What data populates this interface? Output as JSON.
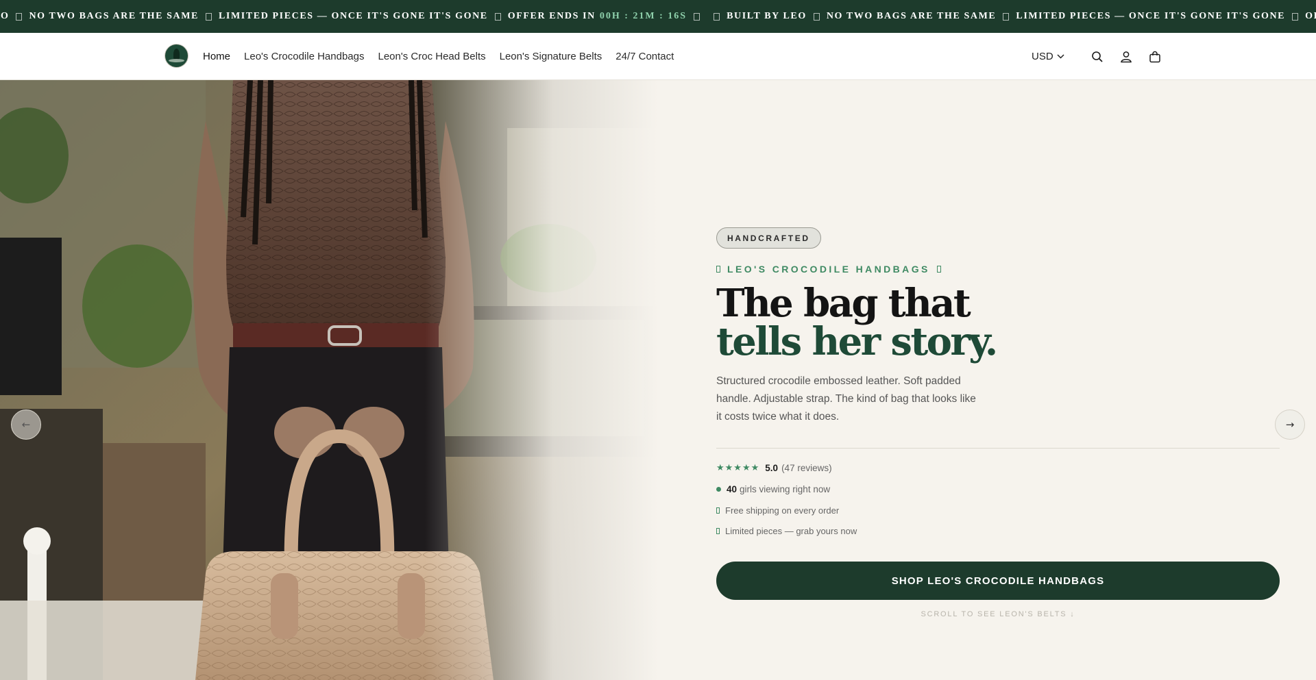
{
  "announcement": {
    "segments": [
      {
        "text": "EO",
        "sep": true
      },
      {
        "text": "NO TWO BAGS ARE THE SAME",
        "sep": true
      },
      {
        "text": "LIMITED PIECES — ONCE IT'S GONE IT'S GONE",
        "sep": true
      },
      {
        "text": "OFFER ENDS IN",
        "timer": "00H : 21M : 16S",
        "sep": true
      },
      {
        "text": "",
        "sep": true
      },
      {
        "text": "BUILT BY LEO",
        "sep": true
      },
      {
        "text": "NO TWO BAGS ARE THE SAME",
        "sep": true
      },
      {
        "text": "LIMITED PIECES — ONCE IT'S GONE IT'S GONE",
        "sep": true
      },
      {
        "text": "OFFER ENDS IN",
        "sep": false
      }
    ],
    "bg_color": "#1d3b2c",
    "timer_color": "#8fd1ac"
  },
  "header": {
    "logo_icon": "brand-logo-tree-icon",
    "nav": [
      {
        "label": "Home",
        "active": true
      },
      {
        "label": "Leo's Crocodile Handbags"
      },
      {
        "label": "Leon's Croc Head Belts"
      },
      {
        "label": "Leon's Signature Belts"
      },
      {
        "label": "24/7 Contact"
      }
    ],
    "currency": "USD",
    "icons": [
      "search-icon",
      "account-icon",
      "cart-icon"
    ]
  },
  "hero": {
    "prev_arrow": "←",
    "next_arrow": "→",
    "badge": "HANDCRAFTED",
    "eyebrow": "LEO'S CROCODILE HANDBAGS",
    "headline_line1": "The bag that",
    "headline_line2": "tells her story.",
    "description": "Structured crocodile embossed leather. Soft padded handle. Adjustable strap. The kind of bag that looks like it costs twice what it does.",
    "rating": {
      "stars": "★★★★★",
      "score": "5.0",
      "reviews": "(47 reviews)"
    },
    "viewing": {
      "count": "40",
      "text": "girls viewing right now"
    },
    "perks": [
      "Free shipping on every order",
      "Limited pieces — grab yours now"
    ],
    "cta": "SHOP LEO'S CROCODILE HANDBAGS",
    "scroll_hint": "SCROLL TO SEE LEON'S BELTS ↓",
    "accent_color": "#3f8a63",
    "dark_green": "#1e4a37"
  }
}
